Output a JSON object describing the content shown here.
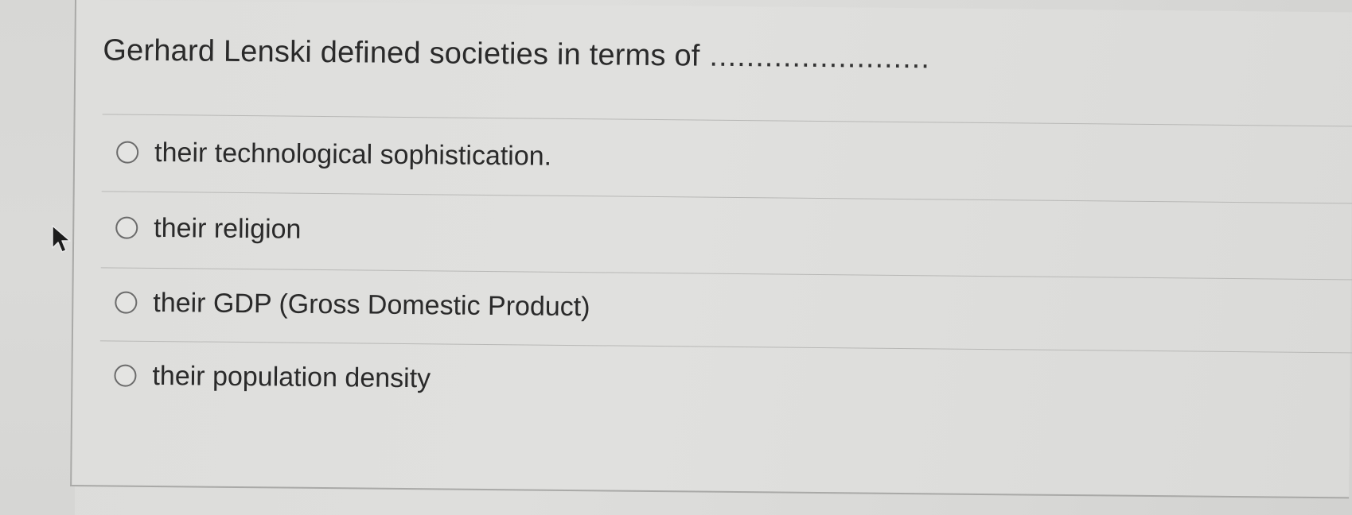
{
  "question": {
    "text": "Gerhard Lenski  defined societies in terms of",
    "blank": "........................"
  },
  "options": [
    {
      "label": "their technological sophistication.",
      "selected": false
    },
    {
      "label": "their religion",
      "selected": false
    },
    {
      "label": "their GDP (Gross Domestic Product)",
      "selected": false
    },
    {
      "label": "their population density",
      "selected": false
    }
  ],
  "icons": {
    "cursor": "mouse-pointer-icon",
    "radio": "radio-unselected-icon"
  },
  "colors": {
    "background": "#dededc",
    "text": "#2a2a2a",
    "radio_border": "#6b6b6b",
    "divider": "#b8b8b6"
  }
}
